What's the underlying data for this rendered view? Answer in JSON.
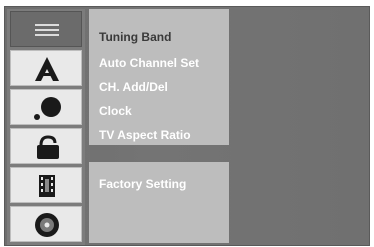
{
  "icon_tabs": [
    {
      "name": "menu-lines-icon",
      "selected": true
    },
    {
      "name": "antenna-icon",
      "selected": false
    },
    {
      "name": "globe-icon",
      "selected": false
    },
    {
      "name": "lock-icon",
      "selected": false
    },
    {
      "name": "film-strip-icon",
      "selected": false
    },
    {
      "name": "disc-icon",
      "selected": false
    }
  ],
  "menu": {
    "items": [
      {
        "label": "Tuning Band"
      },
      {
        "label": "Auto Channel Set"
      },
      {
        "label": "CH. Add/Del"
      },
      {
        "label": "Clock"
      },
      {
        "label": "TV Aspect Ratio"
      }
    ],
    "extra": {
      "label": "Factory Setting"
    }
  },
  "colors": {
    "osd_background": "#707070",
    "panel": "#bdbdbd",
    "text": "#ffffff",
    "active_text": "#3a3a3a"
  }
}
